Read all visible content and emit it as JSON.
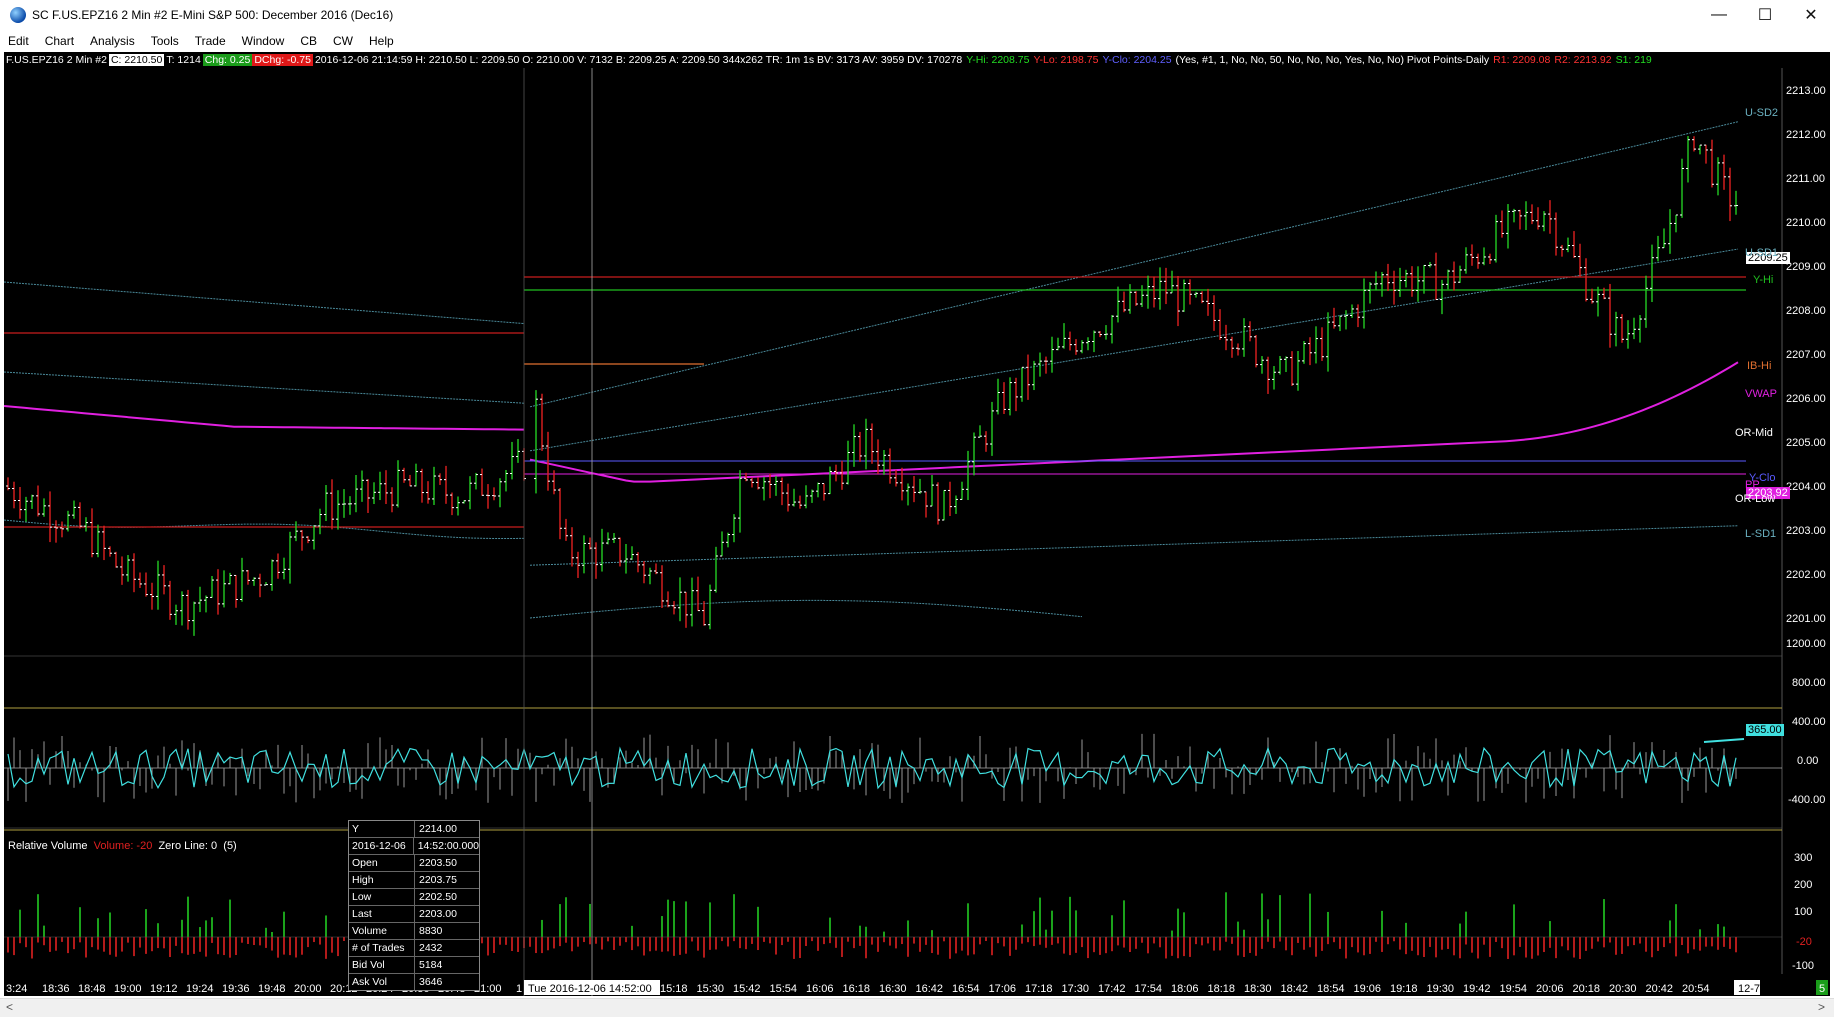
{
  "window": {
    "title": "SC F.US.EPZ16  2 Min  #2  E-Mini S&P 500: December 2016 (Dec16)",
    "minimize_glyph": "—",
    "maximize_glyph": "☐",
    "close_glyph": "✕"
  },
  "menu": [
    "Edit",
    "Chart",
    "Analysis",
    "Tools",
    "Trade",
    "Window",
    "CB",
    "CW",
    "Help"
  ],
  "infobar": {
    "symbol": "F.US.EPZ16  2 Min   #2",
    "close": "C: 2210.50",
    "trades": "T: 1214",
    "chg": "Chg: 0.25",
    "dchg": "DChg: -0.75",
    "ohlc": "2016-12-06 21:14:59 H: 2210.50  L: 2209.50  O: 2210.00  V: 7132  B: 2209.25  A: 2209.50  344x262  TR: 1m 1s  BV: 3173  AV: 3959  DV: 170278",
    "yhi": "Y-Hi: 2208.75",
    "ylo": "Y-Lo: 2198.75",
    "yclo": "Y-Clo: 2204.25",
    "params": "(Yes, #1, 1, No, No, 50, No, No, No, Yes, No, No)  Pivot Points-Daily",
    "r1": "R1: 2209.08",
    "r2": "R2: 2213.92",
    "s1": "S1: 219"
  },
  "price_axis": {
    "ticks": [
      "2213.00",
      "2212.00",
      "2211.00",
      "2210.00",
      "2209.00",
      "2208.00",
      "2207.00",
      "2206.00",
      "2205.00",
      "2204.00",
      "2203.00",
      "2202.00",
      "2201.00"
    ],
    "current_price_badge": "2209.25",
    "vwap_badge": "2203.92"
  },
  "level_labels": {
    "usd2": "U-SD2",
    "usd1": "U-SD1",
    "yhi": "Y-Hi",
    "ibhi": "IB-Hi",
    "vwap": "VWAP",
    "ormid": "OR-Mid",
    "yclo": "Y-Clo",
    "pp": "PP",
    "orlow": "OR-Low",
    "lsd1": "L-SD1"
  },
  "osc_axis": {
    "ticks": [
      "1200.00",
      "800.00",
      "400.00",
      "0.00",
      "-400.00"
    ],
    "badge": "365.00"
  },
  "relvol_axis": {
    "ticks": [
      "300",
      "200",
      "100",
      "-20",
      "-100"
    ]
  },
  "study": {
    "name": "Relative Volume",
    "volume": "Volume: -20",
    "zero": "Zero Line: 0",
    "period": "(5)"
  },
  "time_axis": {
    "ticks": [
      "3:24",
      "18:36",
      "18:48",
      "19:00",
      "19:12",
      "19:24",
      "19:36",
      "19:48",
      "20:00",
      "20:12",
      "20:24",
      "20:36",
      "20:48",
      "21:00",
      "15:18",
      "15:30",
      "15:42",
      "15:54",
      "16:06",
      "16:18",
      "16:30",
      "16:42",
      "16:54",
      "17:06",
      "17:18",
      "17:30",
      "17:42",
      "17:54",
      "18:06",
      "18:18",
      "18:30",
      "18:42",
      "18:54",
      "19:06",
      "19:18",
      "19:30",
      "19:42",
      "19:54",
      "20:06",
      "20:18",
      "20:30",
      "20:42",
      "20:54"
    ],
    "cursor_label": "Tue 2016-12-06  14:52:00",
    "marker1": "1",
    "end_label": "12-7",
    "end_badge": "5"
  },
  "tooltip": [
    {
      "k": "Y",
      "v": "2214.00"
    },
    {
      "k": "2016-12-06",
      "v": "14:52:00.000"
    },
    {
      "k": "Open",
      "v": "2203.50"
    },
    {
      "k": "High",
      "v": "2203.75"
    },
    {
      "k": "Low",
      "v": "2202.50"
    },
    {
      "k": "Last",
      "v": "2203.00"
    },
    {
      "k": "Volume",
      "v": "8830"
    },
    {
      "k": "# of Trades",
      "v": "2432"
    },
    {
      "k": "Bid Vol",
      "v": "5184"
    },
    {
      "k": "Ask Vol",
      "v": "3646"
    }
  ],
  "colors": {
    "background": "#000000",
    "up_bar": "#22cc22",
    "down_bar": "#e02020",
    "vwap": "#e020e0",
    "band": "#4a8a9a",
    "pivot_red": "#c81e1e",
    "yhi_green": "#20c020",
    "yclo_blue": "#5a5aff",
    "osc_line": "#40e0e0",
    "bound_yellow": "#b0a040"
  }
}
